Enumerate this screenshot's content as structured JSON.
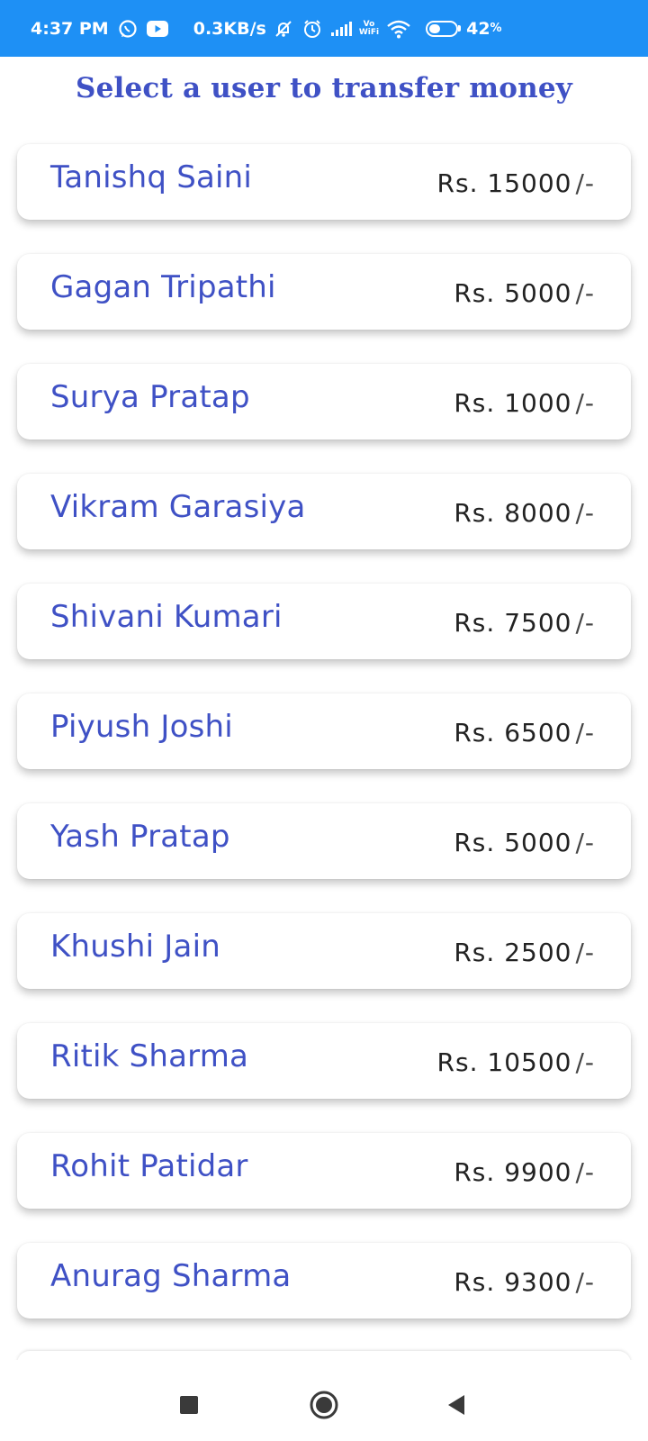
{
  "status_bar": {
    "time": "4:37 PM",
    "speed": "0.3KB/s",
    "vowifi_top": "Vo",
    "vowifi_bottom": "WiFi",
    "battery_level": 0.42,
    "battery_pct": "42",
    "battery_pct_sign": "%",
    "icons": [
      "whatsapp-icon",
      "youtube-icon",
      "notifications-off-icon",
      "alarm-icon",
      "signal-icon",
      "wifi-icon",
      "battery-icon"
    ],
    "bg_color": "#1e90f5"
  },
  "header": {
    "title": "Select a user to transfer money"
  },
  "users": [
    {
      "name": "Tanishq Saini",
      "balance": "Rs. 15000",
      "suffix": "/-"
    },
    {
      "name": "Gagan Tripathi",
      "balance": "Rs. 5000",
      "suffix": "/-"
    },
    {
      "name": "Surya Pratap",
      "balance": "Rs. 1000",
      "suffix": "/-"
    },
    {
      "name": "Vikram Garasiya",
      "balance": "Rs. 8000",
      "suffix": "/-"
    },
    {
      "name": "Shivani Kumari",
      "balance": "Rs. 7500",
      "suffix": "/-"
    },
    {
      "name": "Piyush Joshi",
      "balance": "Rs. 6500",
      "suffix": "/-"
    },
    {
      "name": "Yash Pratap",
      "balance": "Rs. 5000",
      "suffix": "/-"
    },
    {
      "name": "Khushi Jain",
      "balance": "Rs. 2500",
      "suffix": "/-"
    },
    {
      "name": "Ritik Sharma",
      "balance": "Rs. 10500",
      "suffix": "/-"
    },
    {
      "name": "Rohit Patidar",
      "balance": "Rs. 9900",
      "suffix": "/-"
    },
    {
      "name": "Anurag Sharma",
      "balance": "Rs. 9300",
      "suffix": "/-"
    }
  ],
  "nav": {
    "icons": [
      "recents-square-icon",
      "home-circle-icon",
      "back-triangle-icon"
    ]
  },
  "colors": {
    "accent": "#3f51c5",
    "status_bar": "#1e90f5",
    "balance_text": "#222222"
  }
}
